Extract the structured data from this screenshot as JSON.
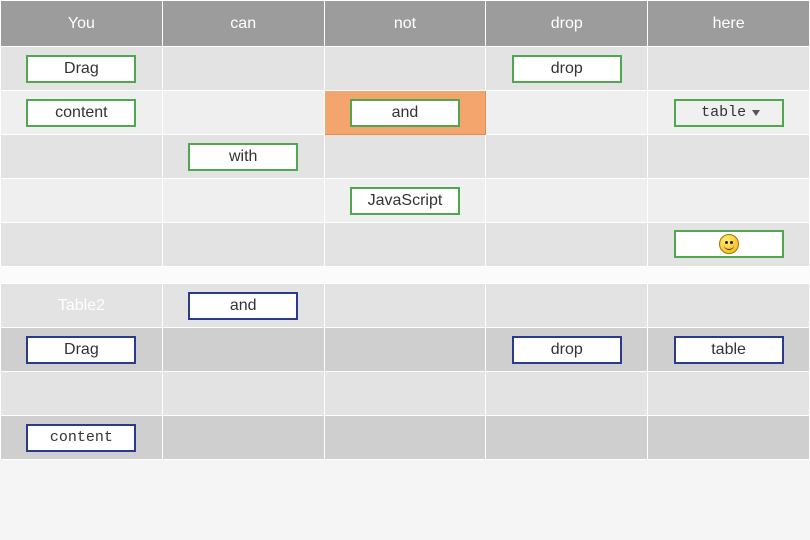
{
  "table1": {
    "headers": [
      "You",
      "can",
      "not",
      "drop",
      "here"
    ],
    "items": {
      "drag": "Drag",
      "drop": "drop",
      "content": "content",
      "and": "and",
      "table_sel": "table",
      "with": "with",
      "javascript": "JavaScript"
    }
  },
  "table2": {
    "header": "Table2",
    "items": {
      "and": "and",
      "drag": "Drag",
      "drop": "drop",
      "table": "table",
      "content": "content"
    }
  }
}
